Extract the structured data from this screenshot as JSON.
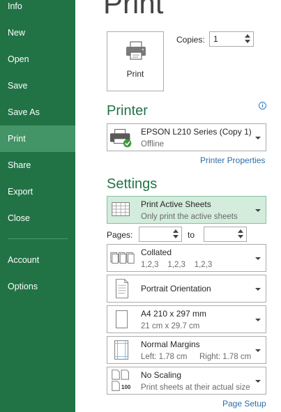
{
  "sidebar": {
    "items": [
      {
        "label": "Info"
      },
      {
        "label": "New"
      },
      {
        "label": "Open"
      },
      {
        "label": "Save"
      },
      {
        "label": "Save As"
      },
      {
        "label": "Print",
        "selected": true
      },
      {
        "label": "Share"
      },
      {
        "label": "Export"
      },
      {
        "label": "Close"
      },
      {
        "label": "Account"
      },
      {
        "label": "Options"
      }
    ]
  },
  "page": {
    "title": "Print"
  },
  "print_button": {
    "label": "Print",
    "icon": "printer-icon"
  },
  "copies": {
    "label": "Copies:",
    "value": "1"
  },
  "printer": {
    "heading": "Printer",
    "name": "EPSON L210 Series (Copy 1)",
    "status": "Offline",
    "properties_link": "Printer Properties",
    "info_icon": "info-icon",
    "info_glyph": "i"
  },
  "settings": {
    "heading": "Settings",
    "what": {
      "title": "Print Active Sheets",
      "subtitle": "Only print the active sheets"
    },
    "pages": {
      "label": "Pages:",
      "to_label": "to",
      "from_value": "",
      "to_value": ""
    },
    "collation": {
      "title": "Collated",
      "subtitle": "1,2,3    1,2,3    1,2,3"
    },
    "orientation": {
      "title": "Portrait Orientation"
    },
    "paper": {
      "title": "A4 210 x 297 mm",
      "subtitle": "21 cm x 29.7 cm"
    },
    "margins": {
      "title": "Normal Margins",
      "left_label": "Left:  1.78 cm",
      "right_label": "Right:  1.78 cm"
    },
    "scaling": {
      "title": "No Scaling",
      "subtitle": "Print sheets at their actual size",
      "icon_text": "100"
    },
    "page_setup_link": "Page Setup"
  },
  "colors": {
    "sidebar_bg": "#217346",
    "sidebar_selected": "#439467",
    "accent_green": "#217346",
    "link_blue": "#2e6ea6",
    "active_dropdown_bg": "#d3ecdc"
  }
}
